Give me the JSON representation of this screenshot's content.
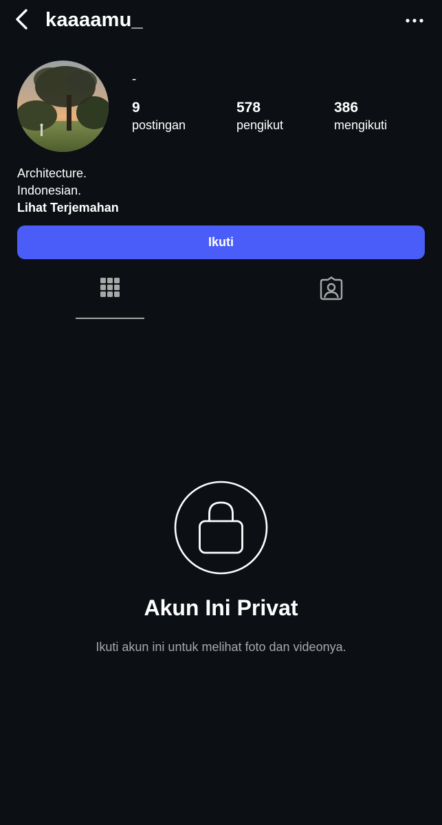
{
  "header": {
    "username": "kaaaamu_",
    "back_icon": "chevron-left-icon",
    "more_icon": "more-horizontal-icon"
  },
  "profile": {
    "display_name": "-",
    "stats": [
      {
        "value": "9",
        "label": "postingan"
      },
      {
        "value": "578",
        "label": "pengikut"
      },
      {
        "value": "386",
        "label": "mengikuti"
      }
    ],
    "bio": {
      "line1": "Architecture.",
      "line2": "Indonesian.",
      "translate_link": "Lihat Terjemahan"
    }
  },
  "actions": {
    "follow_label": "Ikuti",
    "accent_color": "#4a5df9"
  },
  "tabs": [
    {
      "icon": "grid-icon",
      "active": true
    },
    {
      "icon": "tagged-user-icon",
      "active": false
    }
  ],
  "private_notice": {
    "icon": "lock-icon",
    "title": "Akun Ini Privat",
    "subtitle": "Ikuti akun ini untuk melihat foto dan videonya."
  }
}
